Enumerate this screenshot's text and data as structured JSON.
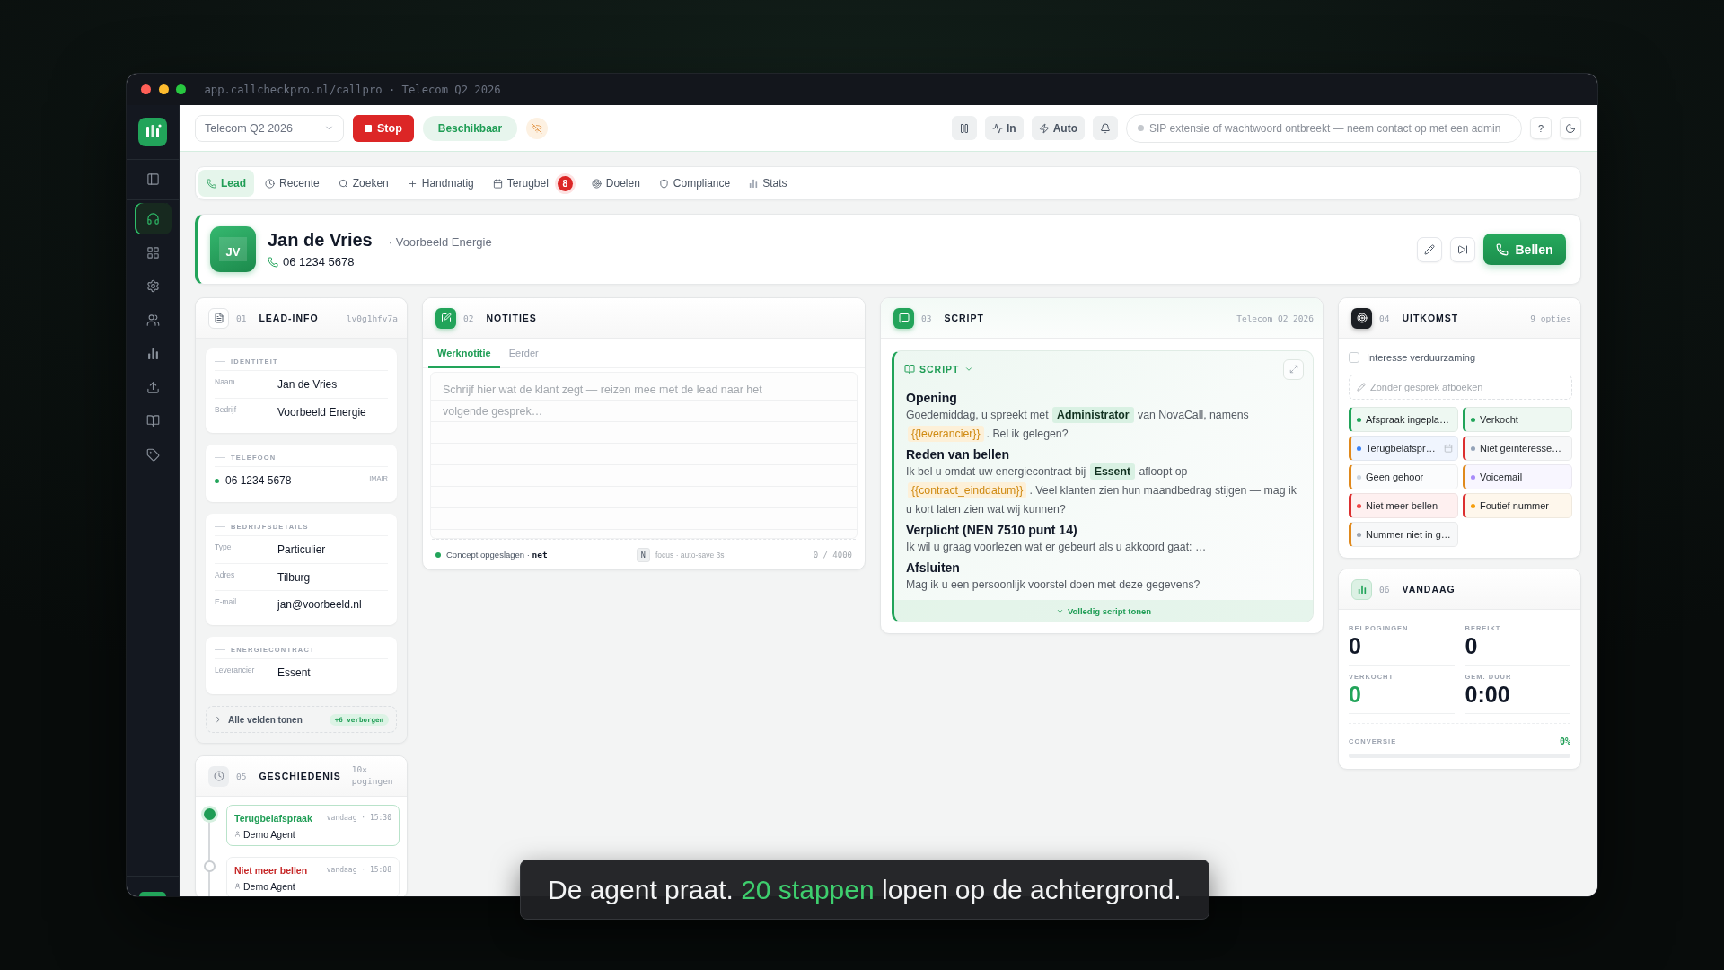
{
  "window": {
    "url": "app.callcheckpro.nl/callpro · Telecom Q2 2026"
  },
  "sidebar": {
    "items": [
      {
        "selected": true
      },
      {
        "selected": false
      },
      {
        "selected": false
      },
      {
        "selected": false
      },
      {
        "selected": false
      },
      {
        "selected": false
      },
      {
        "selected": false
      },
      {
        "selected": false
      }
    ]
  },
  "topbar": {
    "campaign": {
      "value": "Telecom Q2 2026"
    },
    "stop_button": "Stop",
    "availability": "Beschikbaar",
    "direction_button": "In",
    "mode_button": "Auto",
    "sip_status": "SIP extensie of wachtwoord ontbreekt — neem contact op met een admin",
    "help_button": "?"
  },
  "tabs": [
    {
      "label": "Lead",
      "selected": true
    },
    {
      "label": "Recente",
      "selected": false
    },
    {
      "label": "Zoeken",
      "selected": false
    },
    {
      "label": "Handmatig",
      "selected": false
    },
    {
      "label": "Terugbel",
      "selected": false,
      "badge": "8"
    },
    {
      "label": "Doelen",
      "selected": false
    },
    {
      "label": "Compliance",
      "selected": false
    },
    {
      "label": "Stats",
      "selected": false
    }
  ],
  "lead": {
    "initials": "JV",
    "name": "Jan de Vries",
    "company": "· Voorbeeld Energie",
    "phone": "06 1234 5678",
    "call_button": "Bellen"
  },
  "lead_info": {
    "number": "01",
    "title": "LEAD-INFO",
    "record_id": "lv0g1hfv7a",
    "sections": [
      {
        "kind": "fields",
        "title": "IDENTITEIT",
        "fields": [
          {
            "label": "Naam",
            "value": "Jan de Vries"
          },
          {
            "label": "Bedrijf",
            "value": "Voorbeeld Energie"
          }
        ]
      },
      {
        "kind": "phone",
        "title": "TELEFOON",
        "phone": "06 1234 5678",
        "tag": "IMAIR"
      },
      {
        "kind": "fields",
        "title": "BEDRIJFSDETAILS",
        "fields": [
          {
            "label": "Type",
            "value": "Particulier"
          },
          {
            "label": "Adres",
            "value": "Tilburg"
          },
          {
            "label": "E-mail",
            "value": "jan@voorbeeld.nl"
          }
        ]
      },
      {
        "kind": "fields",
        "title": "ENERGIECONTRACT",
        "fields": [
          {
            "label": "Leverancier",
            "value": "Essent"
          }
        ]
      }
    ],
    "show_all": {
      "label": "Alle velden tonen",
      "badge": "+6 verborgen"
    }
  },
  "notes": {
    "number": "02",
    "title": "NOTITIES",
    "tabs": [
      {
        "label": "Werknotitie",
        "selected": true
      },
      {
        "label": "Eerder",
        "selected": false
      }
    ],
    "placeholder": "Schrijf hier wat de klant zegt — reizen mee met de lead naar het volgende gesprek…",
    "status": "Concept opgeslagen · **net**",
    "shortcut": "N",
    "shortcut_hint": "focus · auto-save 3s",
    "counter": "0 / 4000"
  },
  "script": {
    "number": "03",
    "title": "SCRIPT",
    "campaign": "Telecom Q2 2026",
    "dropdown": "SCRIPT",
    "sections": [
      {
        "heading": "Opening",
        "parts": [
          {
            "kind": "text",
            "text": "Goedemiddag, u spreekt met "
          },
          {
            "kind": "field",
            "text": "Administrator"
          },
          {
            "kind": "text",
            "text": " van NovaCall, namens "
          },
          {
            "kind": "variable",
            "text": "{{leverancier}}"
          },
          {
            "kind": "text",
            "text": ". Bel ik gelegen?"
          }
        ]
      },
      {
        "heading": "Reden van bellen",
        "parts": [
          {
            "kind": "text",
            "text": "Ik bel u omdat uw energiecontract bij "
          },
          {
            "kind": "field",
            "text": "Essent"
          },
          {
            "kind": "text",
            "text": " afloopt op "
          },
          {
            "kind": "variable",
            "text": "{{contract_einddatum}}"
          },
          {
            "kind": "text",
            "text": ". Veel klanten zien hun maandbedrag stijgen — mag ik u kort laten zien wat wij kunnen?"
          }
        ]
      },
      {
        "heading": "Verplicht (NEN 7510 punt 14)",
        "parts": [
          {
            "kind": "text",
            "text": "Ik wil u graag voorlezen wat er gebeurt als u akkoord gaat: …"
          }
        ]
      },
      {
        "heading": "Afsluiten",
        "parts": [
          {
            "kind": "text",
            "text": "Mag ik u een persoonlijk voorstel doen met deze gegevens?"
          }
        ]
      }
    ],
    "show_full": "Volledig script tonen"
  },
  "outcome": {
    "number": "04",
    "title": "UITKOMST",
    "count": "9 opties",
    "checkbox": {
      "label": "Interesse verduurzaming",
      "checked": false
    },
    "skip_call": "Zonder gesprek afboeken",
    "options": [
      {
        "label": "Afspraak ingepla…",
        "kind": "positive",
        "color": "#22a45a"
      },
      {
        "label": "Verkocht",
        "kind": "positive",
        "color": "#22a45a"
      },
      {
        "label": "Terugbelafspr…",
        "kind": "callback",
        "color": "#3b82f6"
      },
      {
        "label": "Niet geïnteresse…",
        "kind": "negative",
        "color": "#94a3b8"
      },
      {
        "label": "Geen gehoor",
        "kind": "followup",
        "color": "#cbd5e1"
      },
      {
        "label": "Voicemail",
        "kind": "followup",
        "color": "#a78bfa"
      },
      {
        "label": "Niet meer bellen",
        "kind": "negative",
        "color": "#ef4444"
      },
      {
        "label": "Foutief nummer",
        "kind": "negative",
        "color": "#f59e0b"
      },
      {
        "label": "Nummer niet in g…",
        "kind": "followup",
        "color": "#9ca3af"
      }
    ]
  },
  "today": {
    "number": "06",
    "title": "VANDAAG",
    "stats": [
      {
        "label": "BELPOGINGEN",
        "value": "0",
        "kind": "plain"
      },
      {
        "label": "BEREIKT",
        "value": "0",
        "kind": "plain"
      },
      {
        "label": "VERKOCHT",
        "value": "0",
        "kind": "success"
      },
      {
        "label": "GEM. DUUR",
        "value": "0:00",
        "kind": "plain"
      }
    ],
    "conversion": {
      "label": "CONVERSIE",
      "value": "0%",
      "level": 0
    }
  },
  "history": {
    "number": "05",
    "title": "GESCHIEDENIS",
    "count": "10× pogingen",
    "items": [
      {
        "title": "Terugbelafspraak",
        "time": "vandaag · 15:30",
        "agent": "Demo Agent",
        "color": "#1f9d55",
        "selected": true
      },
      {
        "title": "Niet meer bellen",
        "time": "vandaag · 15:08",
        "agent": "Demo Agent",
        "color": "#c62828",
        "selected": false
      }
    ]
  },
  "caption": {
    "parts": [
      {
        "kind": "text",
        "text": "De agent praat. "
      },
      {
        "kind": "accent",
        "text": "20 stappen"
      },
      {
        "kind": "text",
        "text": " lopen op de achtergrond."
      }
    ]
  }
}
